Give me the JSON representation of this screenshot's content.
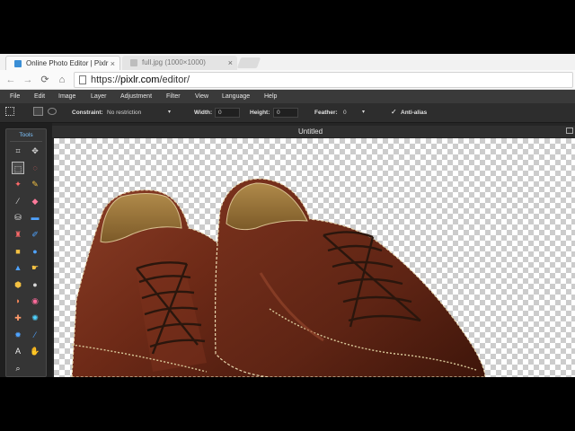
{
  "browser": {
    "tabs": [
      {
        "title": "Online Photo Editor | Pixlr",
        "close": "×",
        "favicon_color": "#3b8fd6"
      },
      {
        "title": "full.jpg (1000×1000)",
        "close": "×",
        "favicon_color": "#9a9a9a"
      }
    ],
    "nav": {
      "back": "←",
      "forward": "→",
      "reload": "⟳",
      "home": "⌂"
    },
    "url": {
      "scheme": "https://",
      "host": "pixlr.com",
      "path": "/editor/"
    }
  },
  "menu": {
    "items": [
      "File",
      "Edit",
      "Image",
      "Layer",
      "Adjustment",
      "Filter",
      "View",
      "Language",
      "Help"
    ]
  },
  "options": {
    "constraint_label": "Constraint:",
    "constraint_value": "No restriction",
    "width_label": "Width:",
    "width_value": "0",
    "height_label": "Height:",
    "height_value": "0",
    "feather_label": "Feather:",
    "feather_value": "0",
    "antialias_label": "Anti-alias",
    "antialias_checked": true,
    "dropdown_arrow": "▾",
    "check_mark": "✓"
  },
  "tools": {
    "title": "Tools",
    "items": [
      {
        "icon": "crop-icon",
        "glyph": "⌗",
        "color": "#d8d8d8"
      },
      {
        "icon": "move-icon",
        "glyph": "✥",
        "color": "#d8d8d8"
      },
      {
        "icon": "marquee-icon",
        "glyph": "⬚",
        "color": "#f0f0f0",
        "selected": true
      },
      {
        "icon": "lasso-icon",
        "glyph": "◌",
        "color": "#ff6a6a"
      },
      {
        "icon": "wand-icon",
        "glyph": "✦",
        "color": "#ff6a6a"
      },
      {
        "icon": "pencil-icon",
        "glyph": "✎",
        "color": "#f4c142"
      },
      {
        "icon": "brush-icon",
        "glyph": "⁄",
        "color": "#d8d8d8"
      },
      {
        "icon": "eraser-icon",
        "glyph": "◆",
        "color": "#ff7a9a"
      },
      {
        "icon": "bucket-icon",
        "glyph": "⛁",
        "color": "#f0f0f0"
      },
      {
        "icon": "gradient-icon",
        "glyph": "▬",
        "color": "#4fa3ff"
      },
      {
        "icon": "stamp-icon",
        "glyph": "♜",
        "color": "#ff6a6a"
      },
      {
        "icon": "colorreplace-icon",
        "glyph": "✐",
        "color": "#4fa3ff"
      },
      {
        "icon": "drawing-icon",
        "glyph": "■",
        "color": "#f4c142"
      },
      {
        "icon": "blur-icon",
        "glyph": "●",
        "color": "#4fa3ff"
      },
      {
        "icon": "sharpen-icon",
        "glyph": "▲",
        "color": "#4fa3ff"
      },
      {
        "icon": "smudge-icon",
        "glyph": "☛",
        "color": "#f4c142"
      },
      {
        "icon": "sponge-icon",
        "glyph": "⬢",
        "color": "#f4c142"
      },
      {
        "icon": "dodge-icon",
        "glyph": "●",
        "color": "#d8d8d8"
      },
      {
        "icon": "burn-icon",
        "glyph": "◗",
        "color": "#ff8a5a"
      },
      {
        "icon": "redeye-icon",
        "glyph": "◉",
        "color": "#ff6a9a"
      },
      {
        "icon": "spotheal-icon",
        "glyph": "✚",
        "color": "#ff9a6a"
      },
      {
        "icon": "bloat-icon",
        "glyph": "✺",
        "color": "#4fd3ff"
      },
      {
        "icon": "pinch-icon",
        "glyph": "✹",
        "color": "#4fa3ff"
      },
      {
        "icon": "eyedropper-icon",
        "glyph": "⁄",
        "color": "#4fa3ff"
      },
      {
        "icon": "type-icon",
        "glyph": "A",
        "color": "#f0f0f0"
      },
      {
        "icon": "hand-icon",
        "glyph": "✋",
        "color": "#f4c142"
      },
      {
        "icon": "zoom-icon",
        "glyph": "⌕",
        "color": "#f0f0f0"
      }
    ]
  },
  "document": {
    "title": "Untitled"
  },
  "colors": {
    "menubar_bg": "#3a3a3a",
    "panel_bg": "#353535",
    "accent": "#7fc5ff",
    "leather": "#6b2d1c"
  }
}
